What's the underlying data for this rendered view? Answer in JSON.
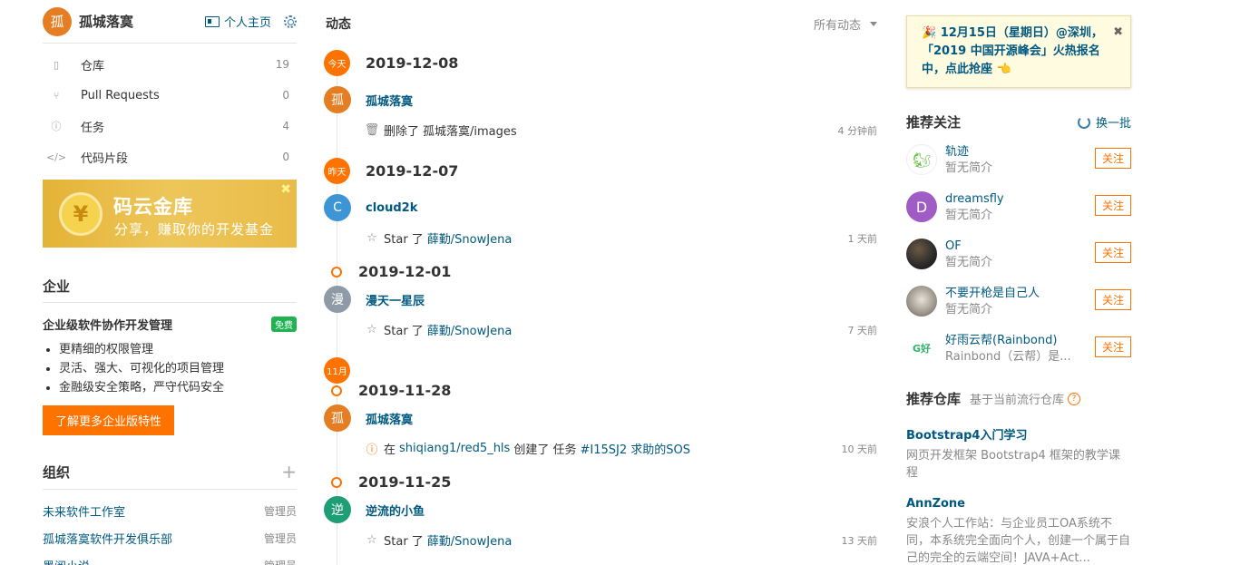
{
  "user": {
    "avatar_char": "孤",
    "name": "孤城落寞",
    "home_label": "个人主页"
  },
  "nav": [
    {
      "label": "仓库",
      "count": "19",
      "icon": "book-icon"
    },
    {
      "label": "Pull Requests",
      "count": "0",
      "icon": "pull-request-icon"
    },
    {
      "label": "任务",
      "count": "4",
      "icon": "issue-icon"
    },
    {
      "label": "代码片段",
      "count": "0",
      "icon": "code-icon"
    }
  ],
  "banner": {
    "title": "码云金库",
    "subtitle": "分享，赚取你的开发基金",
    "coin": "¥",
    "close": "✖"
  },
  "enterprise": {
    "title": "企业",
    "heading": "企业级软件协作开发管理",
    "badge": "免费",
    "features": [
      "更精细的权限管理",
      "灵活、强大、可视化的项目管理",
      "金融级安全策略，严守代码安全"
    ],
    "button": "了解更多企业版特性"
  },
  "orgs": {
    "title": "组织",
    "items": [
      {
        "name": "未来软件工作室",
        "role": "管理员"
      },
      {
        "name": "孤城落寞软件开发俱乐部",
        "role": "管理员"
      },
      {
        "name": "墨阅小说",
        "role": "管理员"
      }
    ]
  },
  "feed": {
    "title": "动态",
    "filter": "所有动态",
    "dates": [
      {
        "badge": "今天",
        "date": "2019-12-08"
      },
      {
        "badge": "昨天",
        "date": "2019-12-07"
      },
      {
        "badge": "",
        "date": "2019-12-01"
      },
      {
        "badge": "11月",
        "date": "2019-11-28"
      },
      {
        "badge": "",
        "date": "2019-11-25"
      }
    ],
    "events": [
      {
        "avatar": "孤",
        "avatar_color": "#e57d22",
        "actor": "孤城落寞",
        "icon": "trash-icon",
        "pre": "删除了",
        "target": "孤城落寞/images",
        "mid": "",
        "target2": "",
        "time": "4 分钟前"
      },
      {
        "avatar": "C",
        "avatar_color": "#3e95d6",
        "actor": "cloud2k",
        "icon": "star-icon",
        "pre": "Star 了",
        "target": "薛勤/SnowJena",
        "mid": "",
        "target2": "",
        "time": "1 天前"
      },
      {
        "avatar": "漫",
        "avatar_color": "#8e9ba6",
        "actor": "漫天一星辰",
        "icon": "star-icon",
        "pre": "Star 了",
        "target": "薛勤/SnowJena",
        "mid": "",
        "target2": "",
        "time": "7 天前"
      },
      {
        "avatar": "孤",
        "avatar_color": "#e57d22",
        "actor": "孤城落寞",
        "icon": "issue-icon",
        "pre": "在",
        "target": "shiqiang1/red5_hls",
        "mid": "创建了 任务",
        "target2": "#I15SJ2 求助的SOS",
        "time": "10 天前"
      },
      {
        "avatar": "逆",
        "avatar_color": "#1d9e74",
        "actor": "逆流的小鱼",
        "icon": "star-icon",
        "pre": "Star 了",
        "target": "薛勤/SnowJena",
        "mid": "",
        "target2": "",
        "time": "13 天前"
      }
    ]
  },
  "promo": {
    "text": "🎉 12月15日（星期日）@深圳，「2019 中国开源峰会」火热报名中，点此抢座 👈",
    "close": "✖"
  },
  "recommend": {
    "title": "推荐关注",
    "refresh": "换一批",
    "follow_label": "关注",
    "users": [
      {
        "name": "轨迹",
        "desc": "暂无简介",
        "avatar": "🐿",
        "color": "#ffffff"
      },
      {
        "name": "dreamsfly",
        "desc": "暂无简介",
        "avatar": "D",
        "color": "#9f5cc4"
      },
      {
        "name": "OF",
        "desc": "暂无简介",
        "avatar": "",
        "color": "#2a2a2a"
      },
      {
        "name": "不要开枪是自己人",
        "desc": "暂无简介",
        "avatar": "",
        "color": "#b9b4ad"
      },
      {
        "name": "好雨云帮(Rainbond)",
        "desc": "Rainbond（云帮）是...",
        "avatar": "G好",
        "color": "#ffffff"
      }
    ]
  },
  "repos": {
    "title": "推荐仓库",
    "subtitle": "基于当前流行仓库",
    "help": "?",
    "items": [
      {
        "name": "Bootstrap4入门学习",
        "desc": "网页开发框架 Bootstrap4 框架的教学课程"
      },
      {
        "name": "AnnZone",
        "desc": "安浪个人工作站：与企业员工OA系统不同，本系统完全面向个人，创建一个属于自己的完全的云端空间！JAVA+Act..."
      }
    ]
  }
}
